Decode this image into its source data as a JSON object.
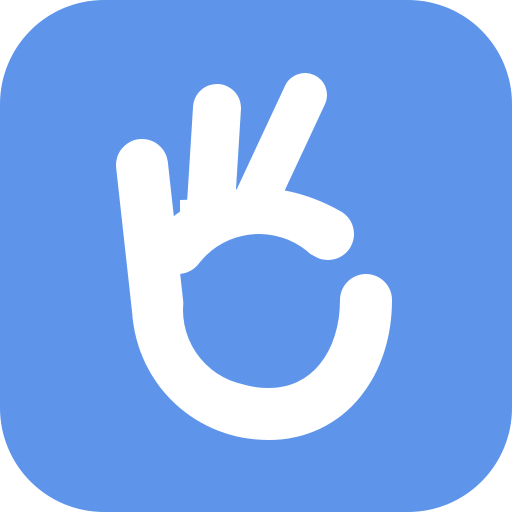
{
  "icon": {
    "semantic": "ok-hand-gesture-icon",
    "colors": {
      "background": "#5E95EA",
      "foreground": "#FFFFFF"
    }
  }
}
